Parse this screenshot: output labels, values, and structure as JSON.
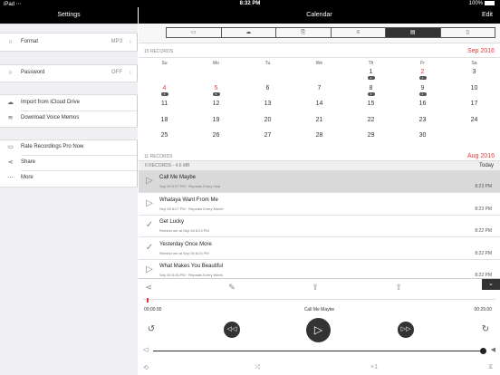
{
  "status": {
    "left": "iPad ⋯",
    "time": "8:32 PM",
    "battery": "100%"
  },
  "settings_title": "Settings",
  "sidebar": {
    "format_label": "Format",
    "format_value": "MP3",
    "password_label": "Password",
    "password_value": "OFF",
    "import_label": "Import from iCloud Drive",
    "download_label": "Download Voice Memos",
    "rate_label": "Rate Recordings Pro Now",
    "share_label": "Share",
    "more_label": "More"
  },
  "nav": {
    "title": "Calendar",
    "edit": "Edit"
  },
  "toolbar_icons": [
    "▭",
    "☁",
    "⎘",
    "≡",
    "▤",
    "▯"
  ],
  "sep16": {
    "count": "15 RECORDS",
    "month": "Sep 2016"
  },
  "weekdays": [
    "Su",
    "Mo",
    "Tu",
    "We",
    "Th",
    "Fr",
    "Sa"
  ],
  "days": [
    [
      "",
      "",
      "",
      "",
      "1",
      "2",
      "3"
    ],
    [
      "4",
      "5",
      "6",
      "7",
      "8",
      "9",
      "10"
    ],
    [
      "11",
      "12",
      "13",
      "14",
      "15",
      "16",
      "17"
    ],
    [
      "18",
      "19",
      "20",
      "21",
      "22",
      "23",
      "24"
    ],
    [
      "25",
      "26",
      "27",
      "28",
      "29",
      "30",
      ""
    ]
  ],
  "badges": {
    "0-4": "2",
    "0-5": "1",
    "1-0": "6",
    "1-1": "5",
    "1-4": "2",
    "1-5": "1"
  },
  "red_days": [
    "0-5",
    "1-0",
    "1-1"
  ],
  "aug16": {
    "count": "11 RECORDS",
    "month": "Aug 2016"
  },
  "subheader": {
    "text": "6 RECORDS - 4.6 MB",
    "today": "Today"
  },
  "items": [
    {
      "title": "Call Me Maybe",
      "detail": "Sep 05 8:27 PM  ·  Repeats Every Year",
      "time": "8:23 PM",
      "icon": "▷"
    },
    {
      "title": "Whataya Want From Me",
      "detail": "Sep 05 8:27 PM  ·  Repeats Every Month",
      "time": "8:23 PM",
      "icon": "▷"
    },
    {
      "title": "Get Lucky",
      "detail": "Remind me at Sep 05 8:23 PM",
      "time": "8:22 PM",
      "icon": "✓"
    },
    {
      "title": "Yesterday Once More",
      "detail": "Remind me at Sep 05 8:23 PM",
      "time": "8:22 PM",
      "icon": "✓"
    },
    {
      "title": "What Makes You Beautiful",
      "detail": "Sep 05 8:26 PM  ·  Repeats Every Week",
      "time": "8:22 PM",
      "icon": "▷"
    }
  ],
  "player": {
    "start": "00:00.00",
    "track": "Call Me Maybe",
    "end": "00:29.00",
    "skip_back": "5",
    "skip_fwd": "5",
    "speed": "×1",
    "progress": 0.01,
    "volume": 0.99
  }
}
